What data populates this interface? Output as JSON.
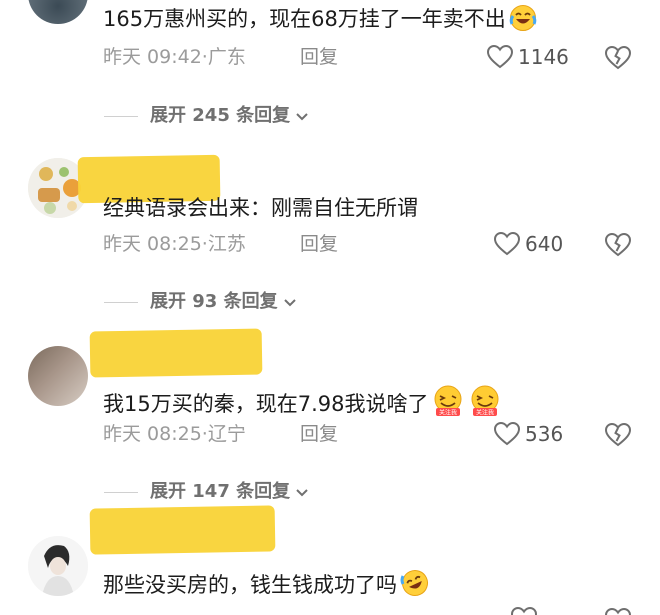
{
  "comments": [
    {
      "text": "165万惠州买的，现在68万挂了一年卖不出",
      "time": "昨天 09:42",
      "location": "广东",
      "reply_label": "回复",
      "likes": "1146",
      "expand": "展开 245 条回复"
    },
    {
      "text": "经典语录会出来：刚需自住无所谓",
      "time": "昨天 08:25",
      "location": "江苏",
      "reply_label": "回复",
      "likes": "640",
      "expand": "展开 93 条回复"
    },
    {
      "text": "我15万买的秦，现在7.98我说啥了",
      "time": "昨天 08:25",
      "location": "辽宁",
      "reply_label": "回复",
      "likes": "536",
      "expand": "展开 147 条回复",
      "sticker_text": "关注我"
    },
    {
      "text": "那些没买房的，钱生钱成功了吗"
    }
  ],
  "icons": {
    "like": "heart-outline-icon",
    "dislike": "broken-heart-icon",
    "expand": "chevron-down-icon",
    "emoji_1": "crying-laughing-emoji",
    "emoji_3": "winking-emoji",
    "emoji_4": "rolling-laughing-emoji"
  },
  "colors": {
    "highlight": "#f9d338",
    "text": "#1c1c1c",
    "meta": "#9b9b9b"
  }
}
